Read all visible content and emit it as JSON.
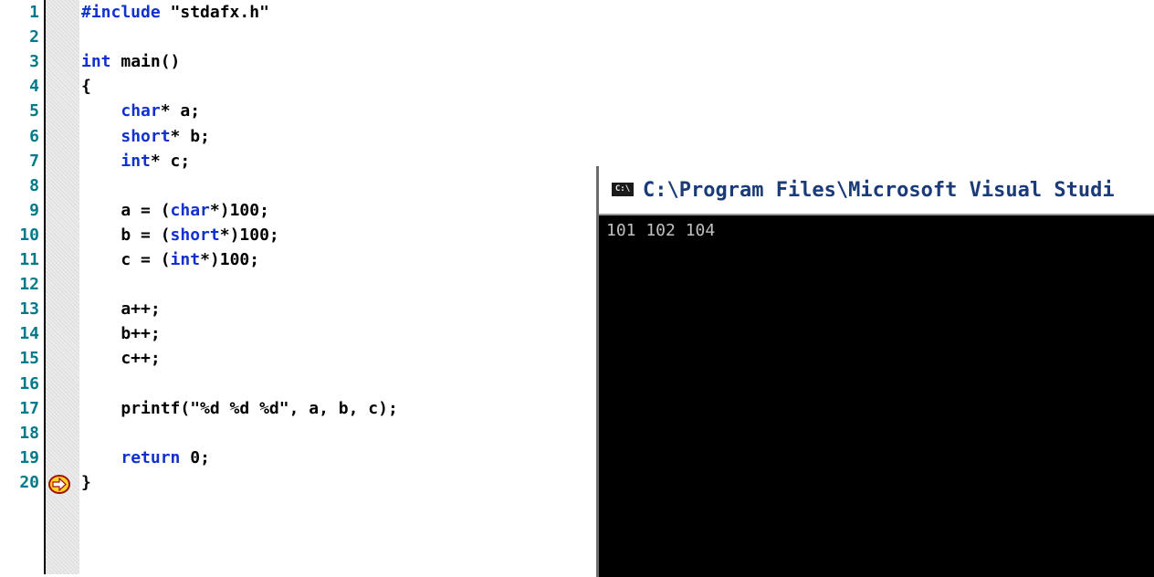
{
  "editor": {
    "line_numbers": [
      "1",
      "2",
      "3",
      "4",
      "5",
      "6",
      "7",
      "8",
      "9",
      "10",
      "11",
      "12",
      "13",
      "14",
      "15",
      "16",
      "17",
      "18",
      "19",
      "20"
    ],
    "lines": [
      [
        {
          "t": "#include",
          "k": true
        },
        {
          "t": " \"stdafx.h\"",
          "k": false
        }
      ],
      [],
      [
        {
          "t": "int",
          "k": true
        },
        {
          "t": " main()",
          "k": false
        }
      ],
      [
        {
          "t": "{",
          "k": false
        }
      ],
      [
        {
          "t": "    ",
          "k": false
        },
        {
          "t": "char",
          "k": true
        },
        {
          "t": "* a;",
          "k": false
        }
      ],
      [
        {
          "t": "    ",
          "k": false
        },
        {
          "t": "short",
          "k": true
        },
        {
          "t": "* b;",
          "k": false
        }
      ],
      [
        {
          "t": "    ",
          "k": false
        },
        {
          "t": "int",
          "k": true
        },
        {
          "t": "* c;",
          "k": false
        }
      ],
      [],
      [
        {
          "t": "    a = (",
          "k": false
        },
        {
          "t": "char",
          "k": true
        },
        {
          "t": "*)100;",
          "k": false
        }
      ],
      [
        {
          "t": "    b = (",
          "k": false
        },
        {
          "t": "short",
          "k": true
        },
        {
          "t": "*)100;",
          "k": false
        }
      ],
      [
        {
          "t": "    c = (",
          "k": false
        },
        {
          "t": "int",
          "k": true
        },
        {
          "t": "*)100;",
          "k": false
        }
      ],
      [],
      [
        {
          "t": "    a++;",
          "k": false
        }
      ],
      [
        {
          "t": "    b++;",
          "k": false
        }
      ],
      [
        {
          "t": "    c++;",
          "k": false
        }
      ],
      [],
      [
        {
          "t": "    printf(\"%d %d %d\", a, b, c);",
          "k": false
        }
      ],
      [],
      [
        {
          "t": "    ",
          "k": false
        },
        {
          "t": "return",
          "k": true
        },
        {
          "t": " 0;",
          "k": false
        }
      ],
      [
        {
          "t": "}",
          "k": false
        }
      ]
    ],
    "current_line": "19",
    "colors": {
      "keyword": "#1030d0",
      "line_number": "#007a8a",
      "text": "#000000"
    }
  },
  "console": {
    "icon_label": "C:\\",
    "title": "C:\\Program Files\\Microsoft Visual Studi",
    "output": "101 102 104"
  }
}
